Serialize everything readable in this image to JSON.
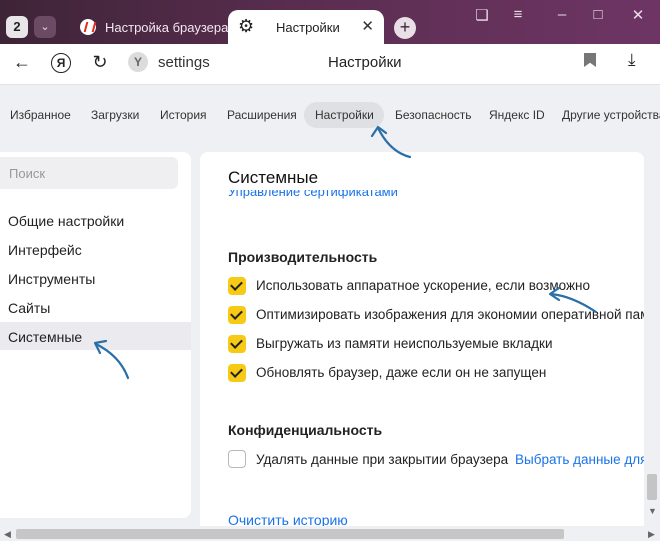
{
  "titlebar": {
    "tab_count": "2",
    "tabs": [
      {
        "title": "Настройка браузера",
        "icon": "yandex-browser-icon"
      },
      {
        "title": "Настройки",
        "icon": "gear-icon"
      }
    ]
  },
  "addressbar": {
    "url": "settings",
    "page_title": "Настройки"
  },
  "menu": {
    "items": [
      "Избранное",
      "Загрузки",
      "История",
      "Расширения",
      "Настройки",
      "Безопасность",
      "Яндекс ID",
      "Другие устройства"
    ],
    "active": "Настройки"
  },
  "sidebar": {
    "search_placeholder": "Поиск",
    "items": [
      "Общие настройки",
      "Интерфейс",
      "Инструменты",
      "Сайты",
      "Системные"
    ],
    "selected": "Системные"
  },
  "main": {
    "section_title": "Системные",
    "cert_link": "Управление сертификатами",
    "performance": {
      "heading": "Производительность",
      "options": [
        {
          "label": "Использовать аппаратное ускорение, если возможно",
          "checked": true
        },
        {
          "label": "Оптимизировать изображения для экономии оперативной памяти",
          "checked": true
        },
        {
          "label": "Выгружать из памяти неиспользуемые вкладки",
          "checked": true
        },
        {
          "label": "Обновлять браузер, даже если он не запущен",
          "checked": true
        }
      ]
    },
    "privacy": {
      "heading": "Конфиденциальность",
      "option_label": "Удалять данные при закрытии браузера",
      "option_checked": false,
      "choose_link": "Выбрать данные для удаления"
    },
    "clear_history": "Очистить историю"
  },
  "colors": {
    "titlebar": "#4a2a43",
    "checkbox": "#f7cb15",
    "link": "#1a73e8",
    "annotation_arrow": "#2a6fa8"
  }
}
